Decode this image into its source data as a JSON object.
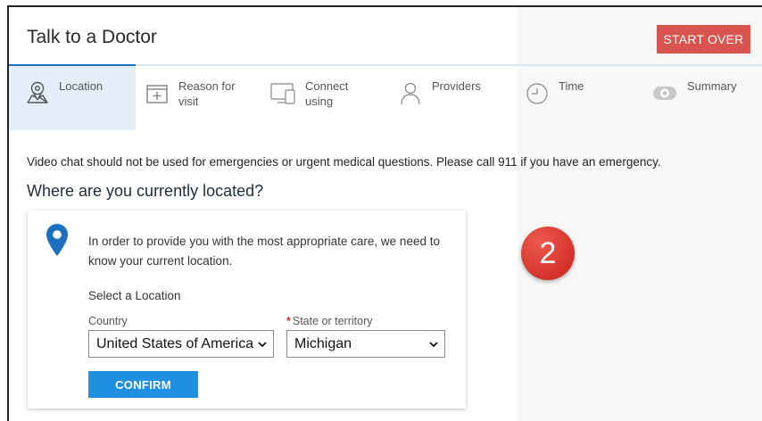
{
  "header": {
    "title": "Talk to a Doctor",
    "start_over_label": "START OVER"
  },
  "steps": [
    {
      "label": "Location",
      "icon": "map-pin-icon",
      "active": true
    },
    {
      "label": "Reason for visit",
      "icon": "plus-box-icon",
      "active": false
    },
    {
      "label": "Connect using",
      "icon": "devices-icon",
      "active": false
    },
    {
      "label": "Providers",
      "icon": "person-icon",
      "active": false
    },
    {
      "label": "Time",
      "icon": "clock-icon",
      "active": false
    },
    {
      "label": "Summary",
      "icon": "eye-icon",
      "active": false
    }
  ],
  "main": {
    "notice": "Video chat should not be used for emergencies or urgent medical questions.  Please call 911 if you have an emergency.",
    "question": "Where are you currently located?",
    "card": {
      "intro": "In order to provide you with the most appropriate care, we need to know your current location.",
      "select_location_label": "Select a Location",
      "country_label": "Country",
      "country_value": "United States of America",
      "state_required_mark": "*",
      "state_label": "State or territory",
      "state_value": "Michigan",
      "confirm_label": "CONFIRM"
    }
  },
  "overlay": {
    "step_number": "2"
  },
  "colors": {
    "accent": "#1e73be",
    "confirm": "#1e8fe1",
    "start_over": "#d9534f",
    "active_tab_bg": "#e4eef8",
    "pin": "#1e6fc0",
    "badge": "#d3322a"
  }
}
